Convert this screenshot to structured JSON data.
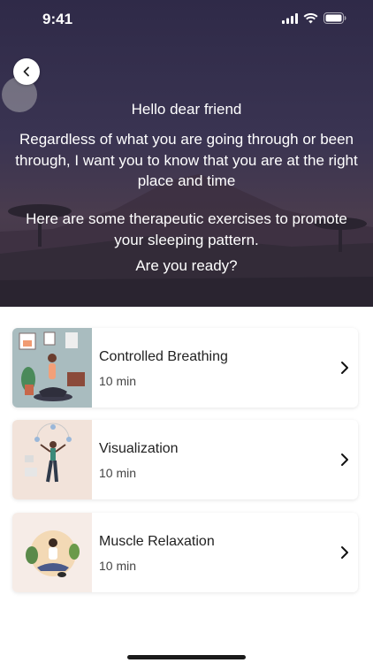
{
  "status_bar": {
    "time": "9:41"
  },
  "header": {
    "greeting": "Hello dear friend",
    "message": "Regardless of what you are going through or been through, I want you to know that you are at the right place and time",
    "exercise_intro": "Here are some therapeutic exercises to promote your sleeping pattern.",
    "ready_prompt": "Are you ready?"
  },
  "exercises": [
    {
      "title": "Controlled Breathing",
      "duration": "10 min",
      "thumb_bg": "#a9bcbf"
    },
    {
      "title": "Visualization",
      "duration": "10 min",
      "thumb_bg": "#f2e3da"
    },
    {
      "title": "Muscle Relaxation",
      "duration": "10 min",
      "thumb_bg": "#f6ece7"
    }
  ],
  "colors": {
    "hero_bg": "#35304a",
    "text_primary": "#222222",
    "text_secondary": "#444444"
  }
}
